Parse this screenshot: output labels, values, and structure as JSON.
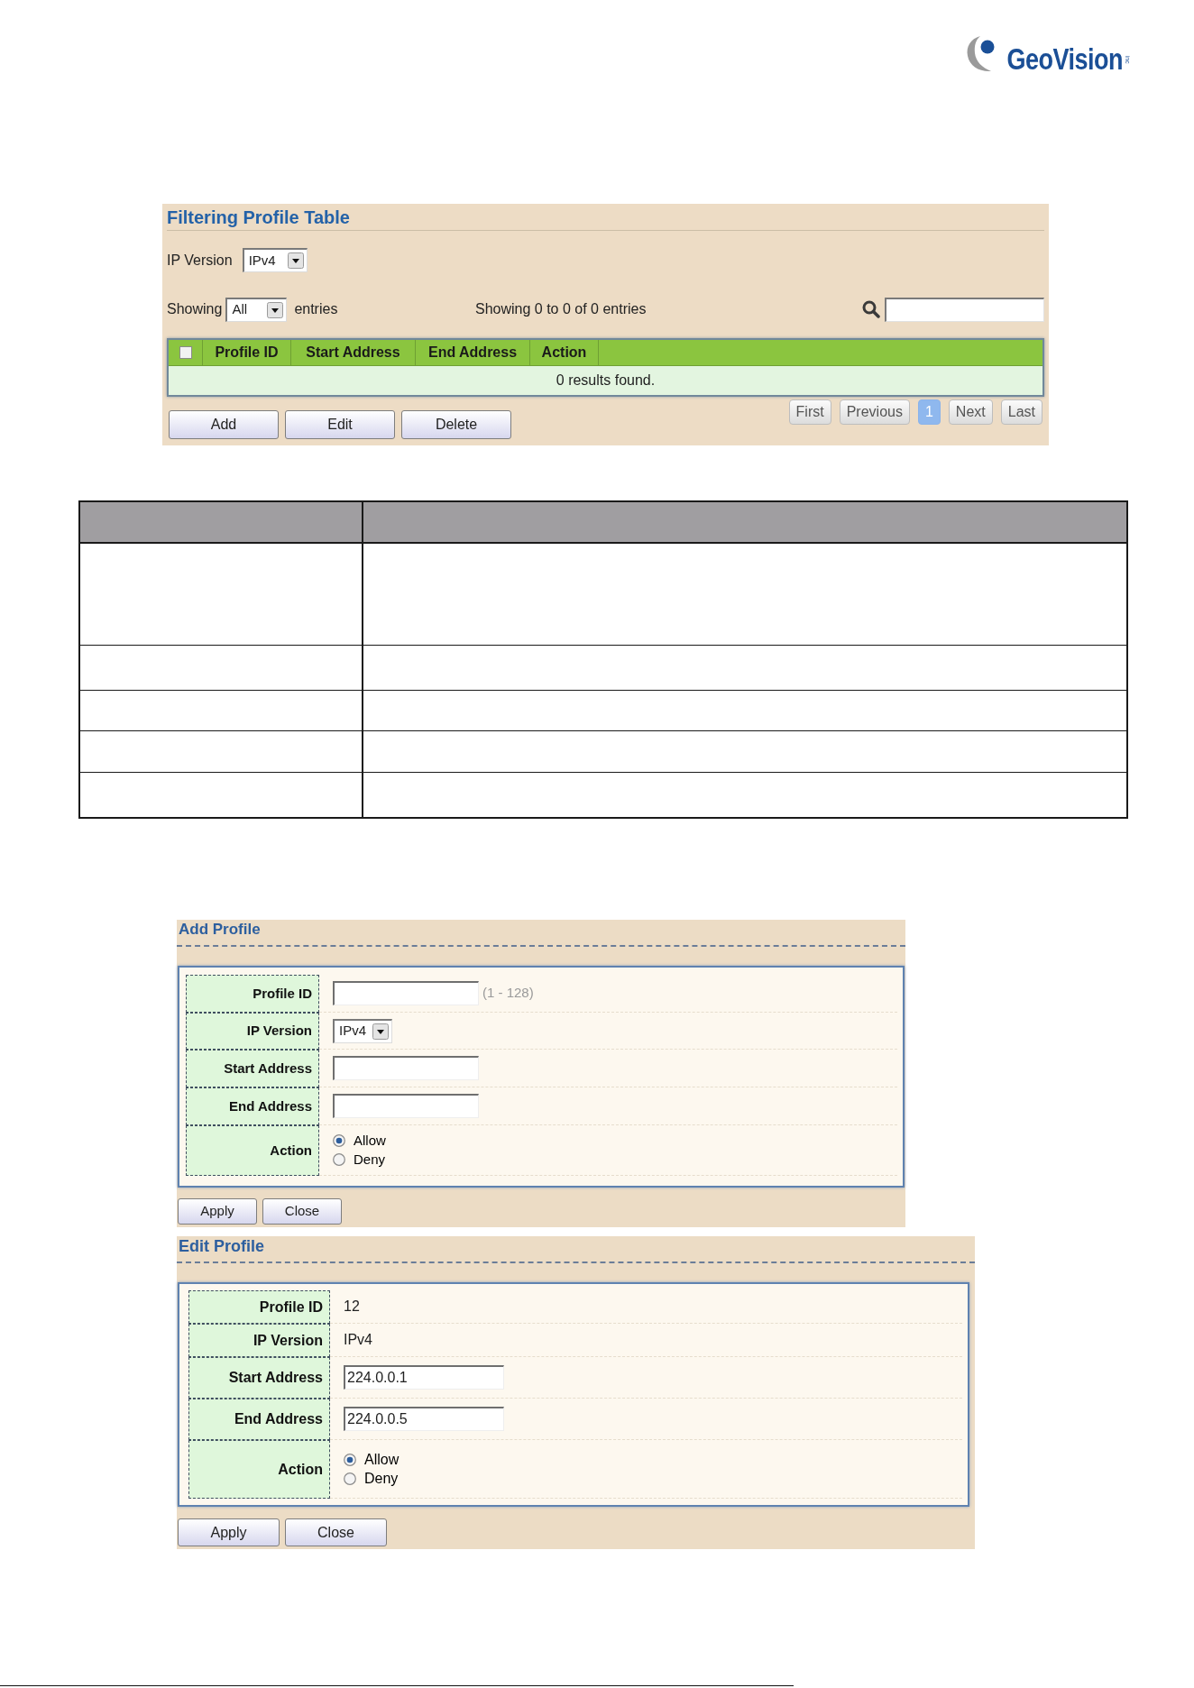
{
  "logo": {
    "name": "GeoVision",
    "suffix": "inc"
  },
  "filtering_profile_table": {
    "title": "Filtering Profile Table",
    "ip_version": {
      "label": "IP Version",
      "value": "IPv4"
    },
    "showing": {
      "label": "Showing",
      "value": "All",
      "suffix": "entries"
    },
    "summary": "Showing 0 to 0 of 0 entries",
    "table": {
      "select_all_checked": false,
      "columns": [
        "Profile ID",
        "Start Address",
        "End Address",
        "Action"
      ],
      "empty_message": "0 results found."
    },
    "buttons": [
      "Add",
      "Edit",
      "Delete"
    ],
    "pagination": [
      {
        "label": "First",
        "selected": false
      },
      {
        "label": "Previous",
        "selected": false
      },
      {
        "label": "1",
        "selected": true
      },
      {
        "label": "Next",
        "selected": false
      },
      {
        "label": "Last",
        "selected": false
      }
    ]
  },
  "add_profile": {
    "title": "Add Profile",
    "fields": [
      {
        "kind": "input",
        "label": "Profile ID",
        "note": "(1 - 128)"
      },
      {
        "kind": "select",
        "label": "IP Version",
        "value": "IPv4"
      },
      {
        "kind": "input",
        "label": "Start Address"
      },
      {
        "kind": "input",
        "label": "End Address"
      },
      {
        "kind": "radio",
        "label": "Action",
        "options": [
          {
            "label": "Allow",
            "selected": true
          },
          {
            "label": "Deny",
            "selected": false
          }
        ]
      }
    ],
    "buttons": [
      "Apply",
      "Close"
    ]
  },
  "edit_profile": {
    "title": "Edit Profile",
    "fields": [
      {
        "kind": "text",
        "label": "Profile ID",
        "value": "12"
      },
      {
        "kind": "text",
        "label": "IP Version",
        "value": "IPv4"
      },
      {
        "kind": "input",
        "label": "Start Address",
        "value": "224.0.0.1"
      },
      {
        "kind": "input",
        "label": "End Address",
        "value": "224.0.0.5"
      },
      {
        "kind": "radio",
        "label": "Action",
        "options": [
          {
            "label": "Allow",
            "selected": true
          },
          {
            "label": "Deny",
            "selected": false
          }
        ]
      }
    ],
    "buttons": [
      "Apply",
      "Close"
    ]
  }
}
